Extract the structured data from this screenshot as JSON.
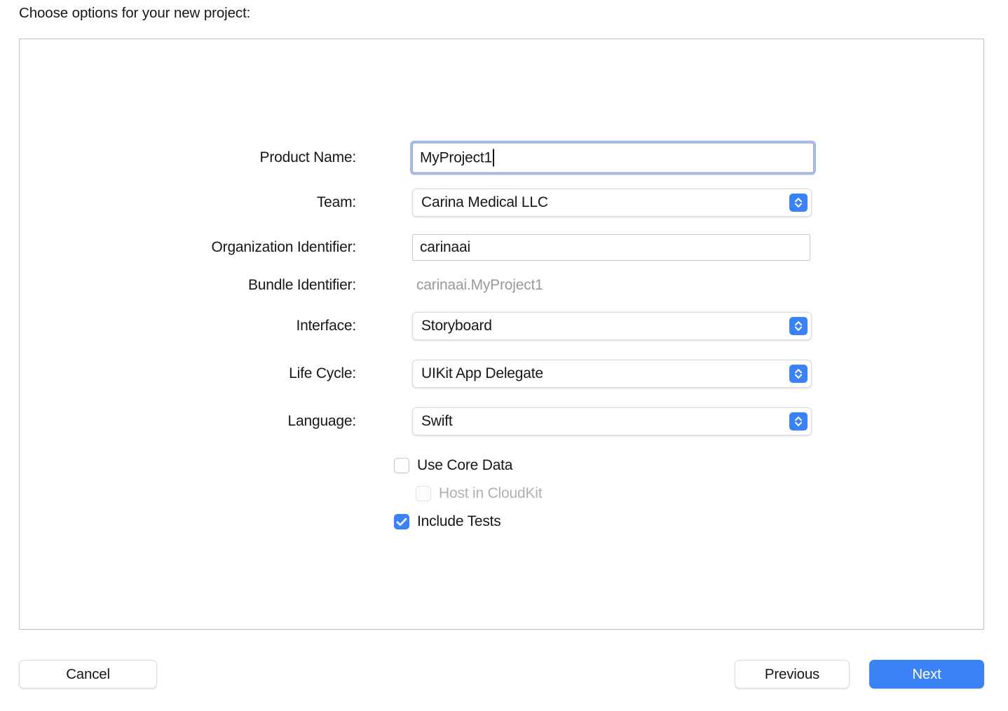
{
  "header": {
    "prompt": "Choose options for your new project:"
  },
  "colors": {
    "accent": "#3b82f7",
    "focus_ring": "#a3bdf0",
    "panel_border": "#bfbfbf",
    "disabled_text": "#b0b0b4",
    "static_text": "#9a9a9e"
  },
  "form": {
    "fields": [
      {
        "label": "Product Name:",
        "type": "text",
        "value": "MyProject1",
        "placeholder": "",
        "focused": true
      },
      {
        "label": "Team:",
        "type": "popup",
        "value": "Carina Medical LLC"
      },
      {
        "label": "Organization Identifier:",
        "type": "text",
        "value": "carinaai",
        "placeholder": "",
        "focused": false
      },
      {
        "label": "Bundle Identifier:",
        "type": "static",
        "value": "carinaai.MyProject1"
      },
      {
        "label": "Interface:",
        "type": "popup",
        "value": "Storyboard"
      },
      {
        "label": "Life Cycle:",
        "type": "popup",
        "value": "UIKit App Delegate"
      },
      {
        "label": "Language:",
        "type": "popup",
        "value": "Swift"
      }
    ],
    "checkboxes": [
      {
        "label": "Use Core Data",
        "checked": false,
        "disabled": false,
        "indented": false
      },
      {
        "label": "Host in CloudKit",
        "checked": false,
        "disabled": true,
        "indented": true
      },
      {
        "label": "Include Tests",
        "checked": true,
        "disabled": false,
        "indented": false
      }
    ]
  },
  "footer": {
    "cancel_label": "Cancel",
    "previous_label": "Previous",
    "next_label": "Next"
  }
}
